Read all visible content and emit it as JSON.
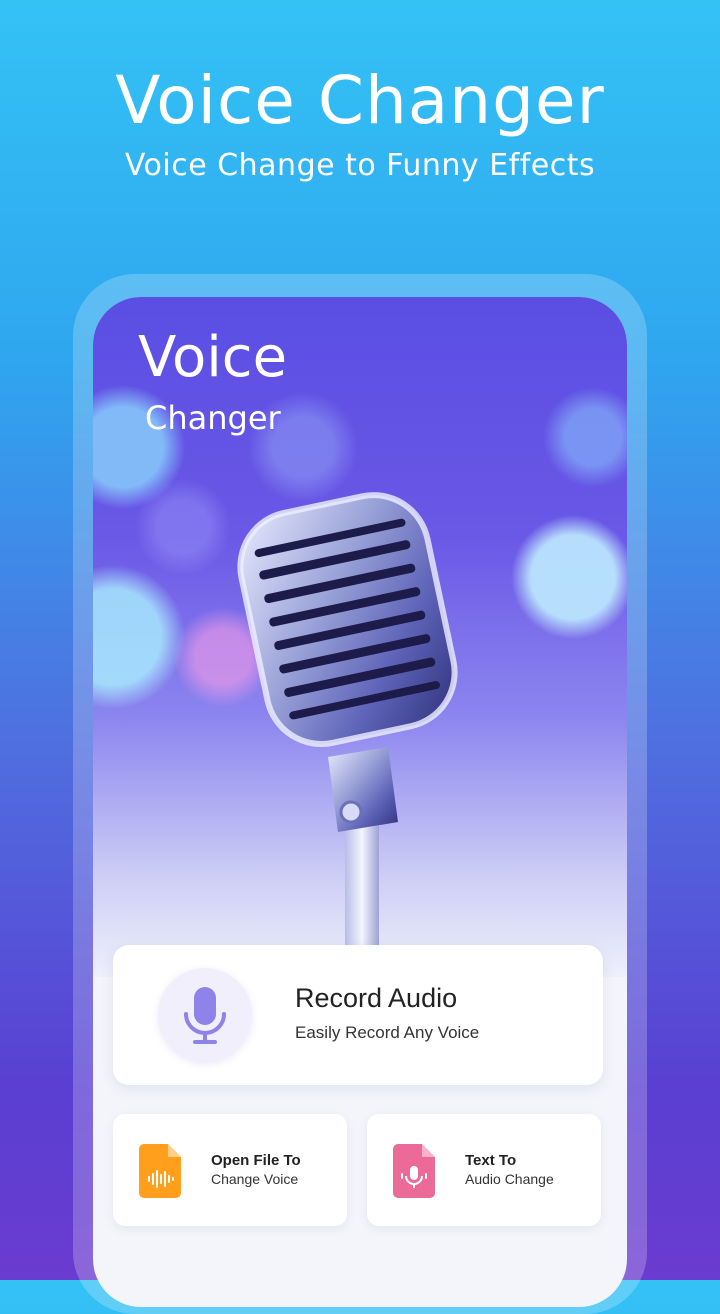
{
  "promo": {
    "title": "Voice Changer",
    "subtitle": "Voice Change to Funny Effects"
  },
  "hero": {
    "title": "Voice",
    "subtitle": "Changer"
  },
  "record": {
    "title": "Record Audio",
    "subtitle": "Easily Record Any Voice",
    "icon": "microphone-icon"
  },
  "open_file": {
    "title": "Open File To",
    "subtitle": "Change Voice",
    "icon": "audio-file-icon",
    "color": "#ff9f1c"
  },
  "text_to_audio": {
    "title": "Text To",
    "subtitle": "Audio Change",
    "icon": "mic-file-icon",
    "color": "#ec6a98"
  },
  "colors": {
    "accent": "#7c6ee8",
    "bg_top": "#34c2f5",
    "bg_bottom": "#6a3ccf"
  }
}
